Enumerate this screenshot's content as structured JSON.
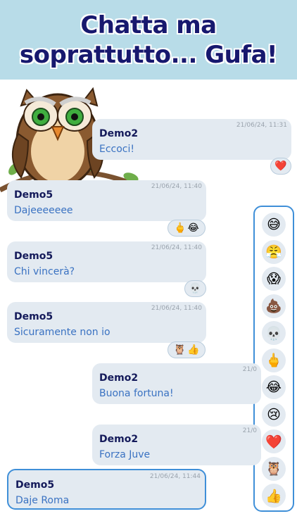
{
  "banner": {
    "line1": "Chatta ma",
    "line2": "soprattutto... Gufa!"
  },
  "messages": [
    {
      "sender": "Demo2",
      "text": "Eccoci!",
      "time": "21/06/24, 11:31",
      "reactions": [
        "❤️"
      ]
    },
    {
      "sender": "Demo5",
      "text": "Dajeeeeeee",
      "time": "21/06/24, 11:40",
      "reactions": [
        "🖕",
        "😂"
      ]
    },
    {
      "sender": "Demo5",
      "text": "Chi vincerà?",
      "time": "21/06/24, 11:40",
      "reactions": [
        "💀"
      ]
    },
    {
      "sender": "Demo5",
      "text": "Sicuramente non io",
      "time": "21/06/24, 11:40",
      "reactions": [
        "🦉",
        "👍"
      ]
    },
    {
      "sender": "Demo2",
      "text": "Buona fortuna!",
      "time": "21/0"
    },
    {
      "sender": "Demo2",
      "text": "Forza Juve",
      "time": "21/0"
    },
    {
      "sender": "Demo5",
      "text": "Daje Roma",
      "time": "21/06/24, 11:44"
    }
  ],
  "reaction_picker": [
    "😅",
    "😤",
    "😱",
    "💩",
    "💀",
    "🖕",
    "😂",
    "😢",
    "❤️",
    "🦉",
    "👍"
  ]
}
